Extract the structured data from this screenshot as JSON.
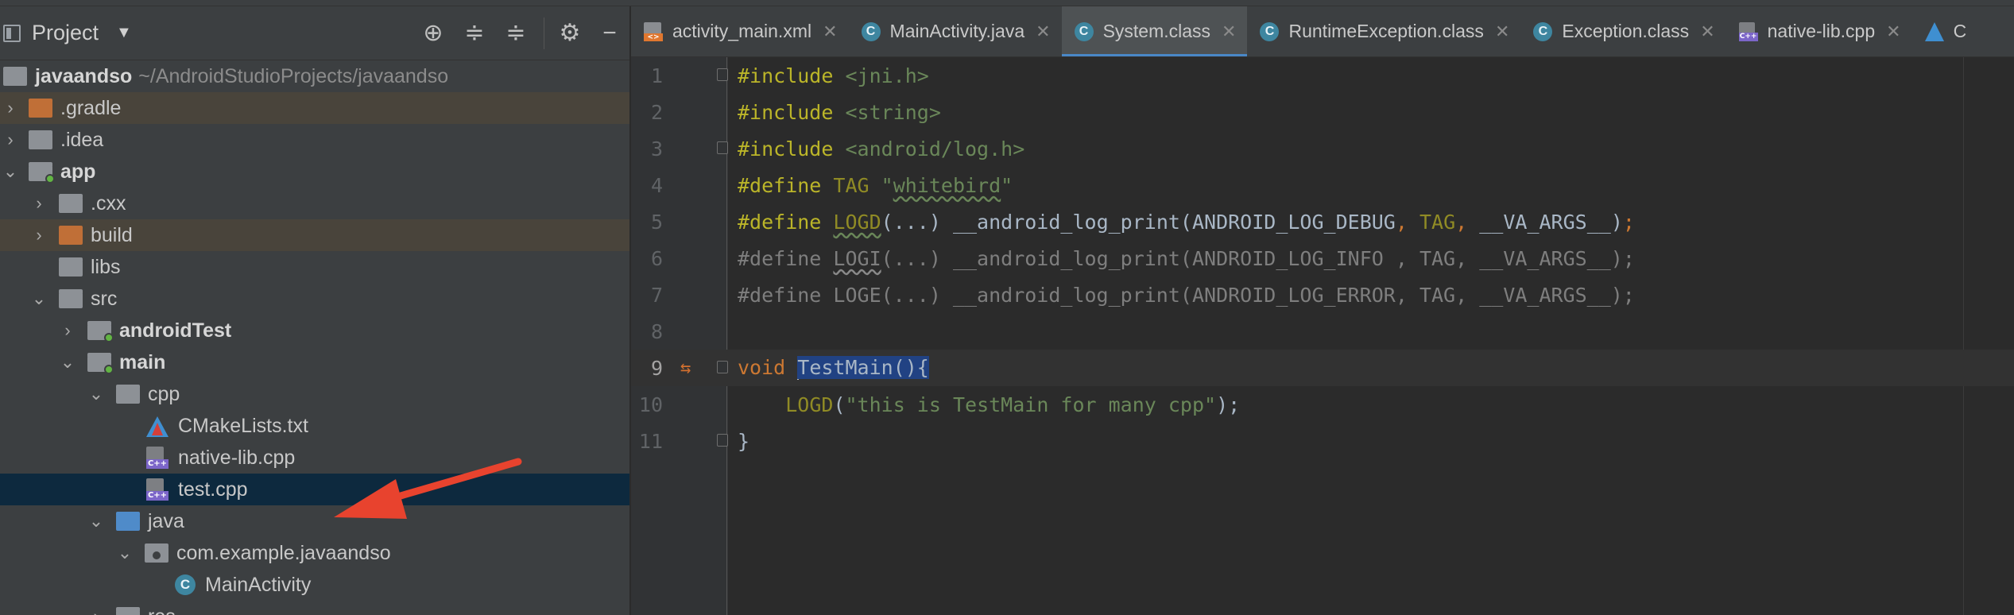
{
  "project_panel": {
    "title": "Project",
    "toolbar": [
      "locate-icon",
      "expand-all-icon",
      "collapse-all-icon",
      "gear-icon",
      "minimize-icon"
    ],
    "tree": [
      {
        "label": "javaandso",
        "path": "~/AndroidStudioProjects/javaandso",
        "depth": 0,
        "expanded": true,
        "type": "module-root"
      },
      {
        "label": ".gradle",
        "depth": 0,
        "type": "folder-orange",
        "chevron": "right"
      },
      {
        "label": ".idea",
        "depth": 0,
        "type": "folder",
        "chevron": "right"
      },
      {
        "label": "app",
        "depth": 0,
        "type": "module",
        "chevron": "down",
        "bold": true
      },
      {
        "label": ".cxx",
        "depth": 1,
        "type": "folder",
        "chevron": "right"
      },
      {
        "label": "build",
        "depth": 1,
        "type": "folder-orange",
        "chevron": "right"
      },
      {
        "label": "libs",
        "depth": 1,
        "type": "folder"
      },
      {
        "label": "src",
        "depth": 1,
        "type": "folder",
        "chevron": "down"
      },
      {
        "label": "androidTest",
        "depth": 2,
        "type": "source-root",
        "chevron": "right",
        "bold": true
      },
      {
        "label": "main",
        "depth": 2,
        "type": "source-root",
        "chevron": "down",
        "bold": true
      },
      {
        "label": "cpp",
        "depth": 3,
        "type": "folder",
        "chevron": "down"
      },
      {
        "label": "CMakeLists.txt",
        "depth": 4,
        "type": "cmake"
      },
      {
        "label": "native-lib.cpp",
        "depth": 4,
        "type": "cpp"
      },
      {
        "label": "test.cpp",
        "depth": 4,
        "type": "cpp",
        "selected": true
      },
      {
        "label": "java",
        "depth": 3,
        "type": "folder-blue",
        "chevron": "down"
      },
      {
        "label": "com.example.javaandso",
        "depth": 4,
        "type": "package",
        "chevron": "down"
      },
      {
        "label": "MainActivity",
        "depth": 5,
        "type": "class"
      },
      {
        "label": "res",
        "depth": 3,
        "type": "folder",
        "chevron": "right"
      }
    ]
  },
  "editor": {
    "tabs": [
      {
        "label": "activity_main.xml",
        "icon": "xml-file-icon"
      },
      {
        "label": "MainActivity.java",
        "icon": "class-icon"
      },
      {
        "label": "System.class",
        "icon": "class-icon",
        "active": true
      },
      {
        "label": "RuntimeException.class",
        "icon": "class-icon"
      },
      {
        "label": "Exception.class",
        "icon": "class-icon"
      },
      {
        "label": "native-lib.cpp",
        "icon": "cpp-file-icon"
      },
      {
        "label": "C",
        "icon": "cmake-file-icon"
      }
    ],
    "line_numbers": [
      "1",
      "2",
      "3",
      "4",
      "5",
      "6",
      "7",
      "8",
      "9",
      "10",
      "11"
    ],
    "code": {
      "l1_kw": "#include",
      "l1_str": " <jni.h>",
      "l2_kw": "#include",
      "l2_str": " <string>",
      "l3_kw": "#include",
      "l3_str": " <android/log.h>",
      "l4_kw": "#define",
      "l4_name": " TAG ",
      "l4_q1": "\"",
      "l4_val": "whitebird",
      "l4_q2": "\"",
      "l5_kw": "#define ",
      "l5_macro": "LOGD",
      "l5_rest": "(...) __android_log_print(ANDROID_LOG_DEBUG",
      "l5_c1": ",",
      "l5_tag": " TAG",
      "l5_c2": ",",
      "l5_va": " __VA_ARGS__)",
      "l5_semi": ";",
      "l6_kw": "#define ",
      "l6_macro": "LOGI",
      "l6_rest": "(...) __android_log_print(ANDROID_LOG_INFO , TAG, __VA_ARGS__);",
      "l7_kw": "#define ",
      "l7_rest": "LOGE(...) __android_log_print(ANDROID_LOG_ERROR, TAG, __VA_ARGS__);",
      "l9_kw": "void ",
      "l9_func": "TestMain",
      "l9_rest": "(){",
      "l10_indent": "    ",
      "l10_call": "LOGD",
      "l10_open": "(",
      "l10_str": "\"this is TestMain for many cpp\"",
      "l10_close": ");",
      "l11": "}"
    }
  }
}
